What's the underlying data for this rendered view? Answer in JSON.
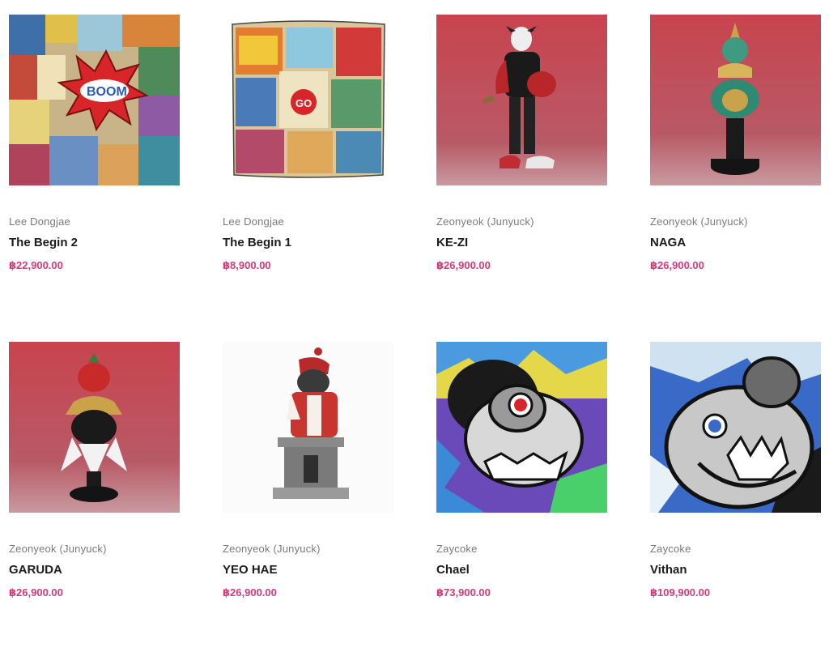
{
  "products": [
    {
      "artist": "Lee Dongjae",
      "title": "The Begin 2",
      "price": "฿22,900.00",
      "image": "comic-collage-boom"
    },
    {
      "artist": "Lee Dongjae",
      "title": "The Begin 1",
      "price": "฿8,900.00",
      "image": "comic-collage-bag"
    },
    {
      "artist": "Zeonyeok (Junyuck)",
      "title": "KE-ZI",
      "price": "฿26,900.00",
      "image": "figure-kezi"
    },
    {
      "artist": "Zeonyeok (Junyuck)",
      "title": "NAGA",
      "price": "฿26,900.00",
      "image": "figure-naga"
    },
    {
      "artist": "Zeonyeok (Junyuck)",
      "title": "GARUDA",
      "price": "฿26,900.00",
      "image": "figure-garuda"
    },
    {
      "artist": "Zeonyeok (Junyuck)",
      "title": "YEO HAE",
      "price": "฿26,900.00",
      "image": "figure-yeo-hae"
    },
    {
      "artist": "Zaycoke",
      "title": "Chael",
      "price": "฿73,900.00",
      "image": "painting-chael"
    },
    {
      "artist": "Zaycoke",
      "title": "Vithan",
      "price": "฿109,900.00",
      "image": "painting-vithan"
    }
  ],
  "colors": {
    "price": "#d63a7b",
    "title": "#1c1c1c",
    "artist": "#7a7a7a"
  }
}
